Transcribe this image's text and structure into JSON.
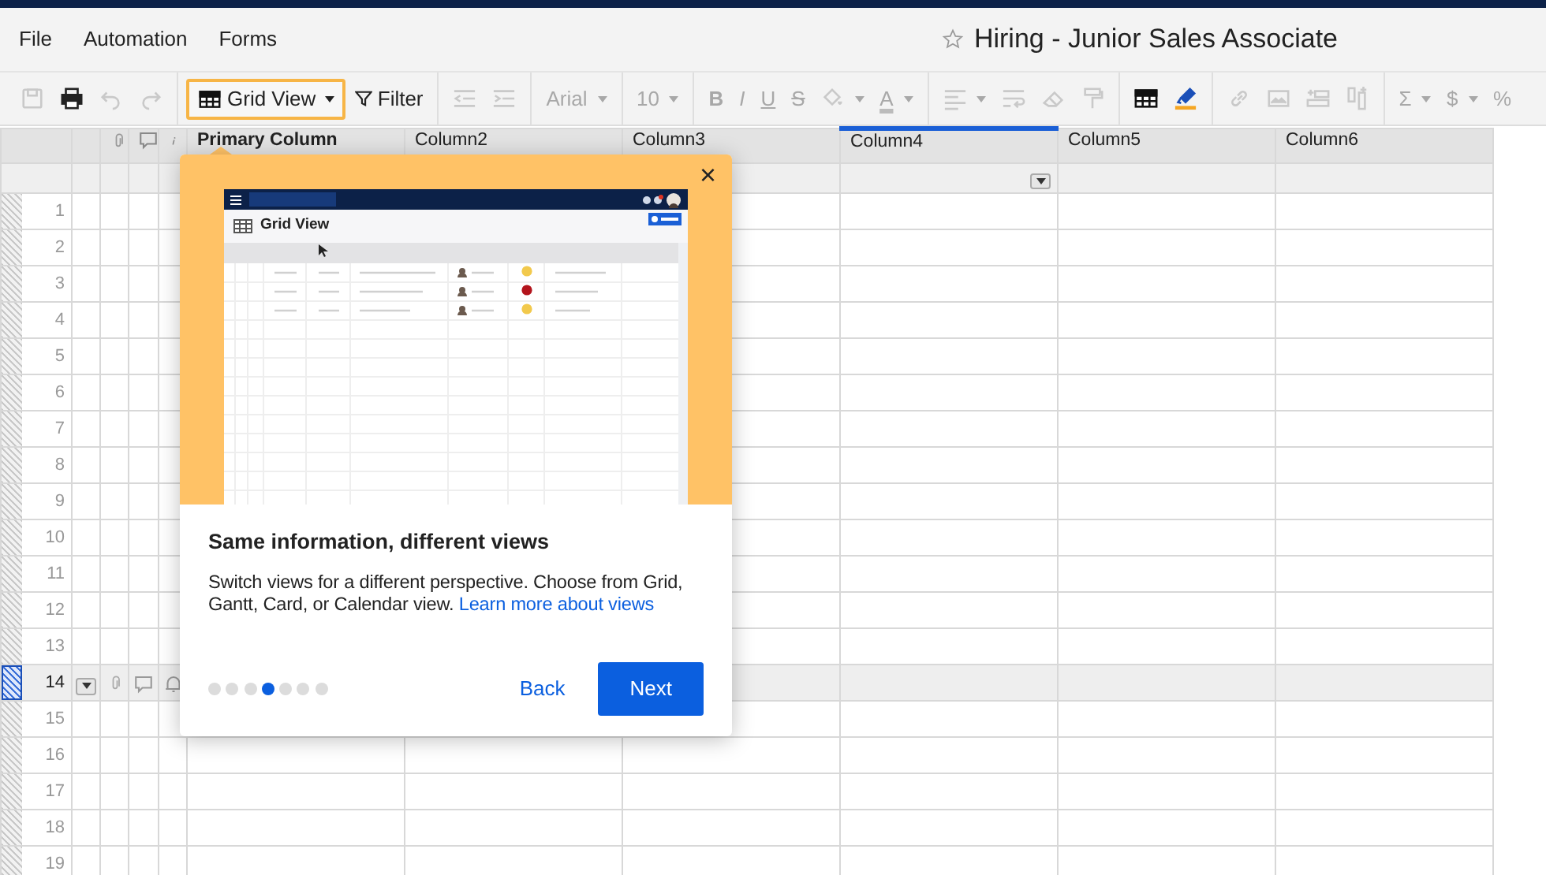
{
  "window": {
    "title": "Hiring - Junior Sales Associate",
    "starred": false
  },
  "menu": [
    {
      "label": "File"
    },
    {
      "label": "Automation"
    },
    {
      "label": "Forms"
    }
  ],
  "toolbar": [
    [
      {
        "kind": "icon",
        "disabled": true
      },
      {
        "kind": "icon",
        "disabled": false
      },
      {
        "kind": "icon",
        "disabled": true
      },
      {
        "kind": "icon",
        "disabled": true
      }
    ],
    [
      {
        "kind": "view",
        "label": "Grid View",
        "highlighted": true,
        "dropdown": true
      },
      {
        "kind": "filter",
        "label": "Filter"
      }
    ],
    [
      {
        "kind": "icon",
        "disabled": true
      },
      {
        "kind": "icon",
        "disabled": true
      }
    ],
    [
      {
        "kind": "text",
        "label": "Arial",
        "dropdown": true,
        "disabled": true
      }
    ],
    [
      {
        "kind": "text",
        "label": "10",
        "dropdown": true,
        "disabled": true
      }
    ],
    [
      {
        "kind": "bold",
        "label": "B",
        "disabled": true
      },
      {
        "kind": "italic",
        "label": "I",
        "disabled": true
      },
      {
        "kind": "underline",
        "label": "U",
        "disabled": true
      },
      {
        "kind": "strike",
        "label": "S",
        "disabled": true
      },
      {
        "kind": "icon",
        "dropdown": true,
        "disabled": true
      },
      {
        "kind": "fontcolor",
        "label": "A",
        "dropdown": true,
        "disabled": true
      }
    ],
    [
      {
        "kind": "icon",
        "dropdown": true,
        "disabled": true
      },
      {
        "kind": "icon",
        "disabled": true
      },
      {
        "kind": "icon",
        "disabled": true
      },
      {
        "kind": "icon",
        "disabled": true
      }
    ],
    [
      {
        "kind": "icon",
        "disabled": false
      },
      {
        "kind": "icon",
        "disabled": false
      }
    ],
    [
      {
        "kind": "icon",
        "disabled": true
      },
      {
        "kind": "icon",
        "disabled": true
      },
      {
        "kind": "icon",
        "disabled": true
      },
      {
        "kind": "icon",
        "disabled": true
      }
    ],
    [
      {
        "kind": "text",
        "label": "Σ",
        "dropdown": true,
        "disabled": true
      },
      {
        "kind": "text",
        "label": "$",
        "dropdown": true,
        "disabled": true
      },
      {
        "kind": "text",
        "label": "%",
        "disabled": true
      }
    ]
  ],
  "columns": [
    {
      "label": "Primary Column",
      "selected": false
    },
    {
      "label": "Column2",
      "selected": false
    },
    {
      "label": "Column3",
      "selected": false
    },
    {
      "label": "Column4",
      "selected": true
    },
    {
      "label": "Column5",
      "selected": false
    },
    {
      "label": "Column6",
      "selected": false
    }
  ],
  "rows": [
    {
      "number": "1",
      "selected": false
    },
    {
      "number": "2",
      "selected": false
    },
    {
      "number": "3",
      "selected": false
    },
    {
      "number": "4",
      "selected": false
    },
    {
      "number": "5",
      "selected": false
    },
    {
      "number": "6",
      "selected": false
    },
    {
      "number": "7",
      "selected": false
    },
    {
      "number": "8",
      "selected": false
    },
    {
      "number": "9",
      "selected": false
    },
    {
      "number": "10",
      "selected": false
    },
    {
      "number": "11",
      "selected": false
    },
    {
      "number": "12",
      "selected": false
    },
    {
      "number": "13",
      "selected": false
    },
    {
      "number": "14",
      "selected": true
    },
    {
      "number": "15",
      "selected": false
    },
    {
      "number": "16",
      "selected": false
    },
    {
      "number": "17",
      "selected": false
    },
    {
      "number": "18",
      "selected": false
    },
    {
      "number": "19",
      "selected": false
    }
  ],
  "tour": {
    "close": "×",
    "screenshot": {
      "title": "Grid View",
      "rows": [
        {
          "color": "#f2c94c"
        },
        {
          "color": "#b3141c"
        },
        {
          "color": "#f2c94c"
        }
      ]
    },
    "heading": "Same information, different views",
    "body": "Switch views for a different perspective. Choose from Grid, Gantt, Card, or Calendar view.",
    "link": "Learn more about views",
    "steps": [
      {
        "selected": false
      },
      {
        "selected": false
      },
      {
        "selected": false
      },
      {
        "selected": true
      },
      {
        "selected": false
      },
      {
        "selected": false
      },
      {
        "selected": false
      }
    ],
    "back": "Back",
    "next": "Next"
  }
}
